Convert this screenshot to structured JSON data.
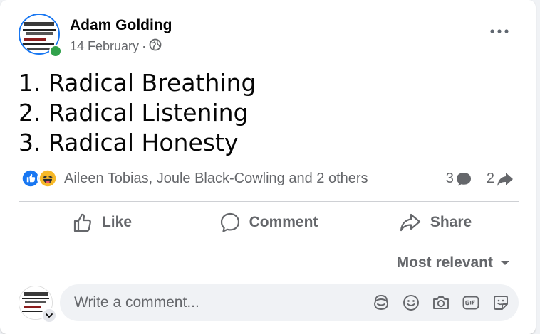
{
  "post": {
    "author": "Adam Golding",
    "date": "14 February",
    "date_separator": "·",
    "audience_icon": "globe-icon",
    "lines": [
      "1. Radical Breathing",
      "2. Radical Listening",
      "3. Radical Honesty"
    ]
  },
  "reactions": {
    "types": [
      "like-reaction-icon",
      "haha-reaction-icon"
    ],
    "names": "Aileen Tobias, Joule Black-Cowling and 2 others",
    "comment_count": "3",
    "share_count": "2"
  },
  "actions": {
    "like": "Like",
    "comment": "Comment",
    "share": "Share"
  },
  "comments": {
    "sort_label": "Most relevant",
    "placeholder": "Write a comment..."
  },
  "colors": {
    "accent": "#1877f2",
    "online": "#31a24c",
    "secondary_text": "#65676b",
    "composer_bg": "#f0f2f5"
  }
}
